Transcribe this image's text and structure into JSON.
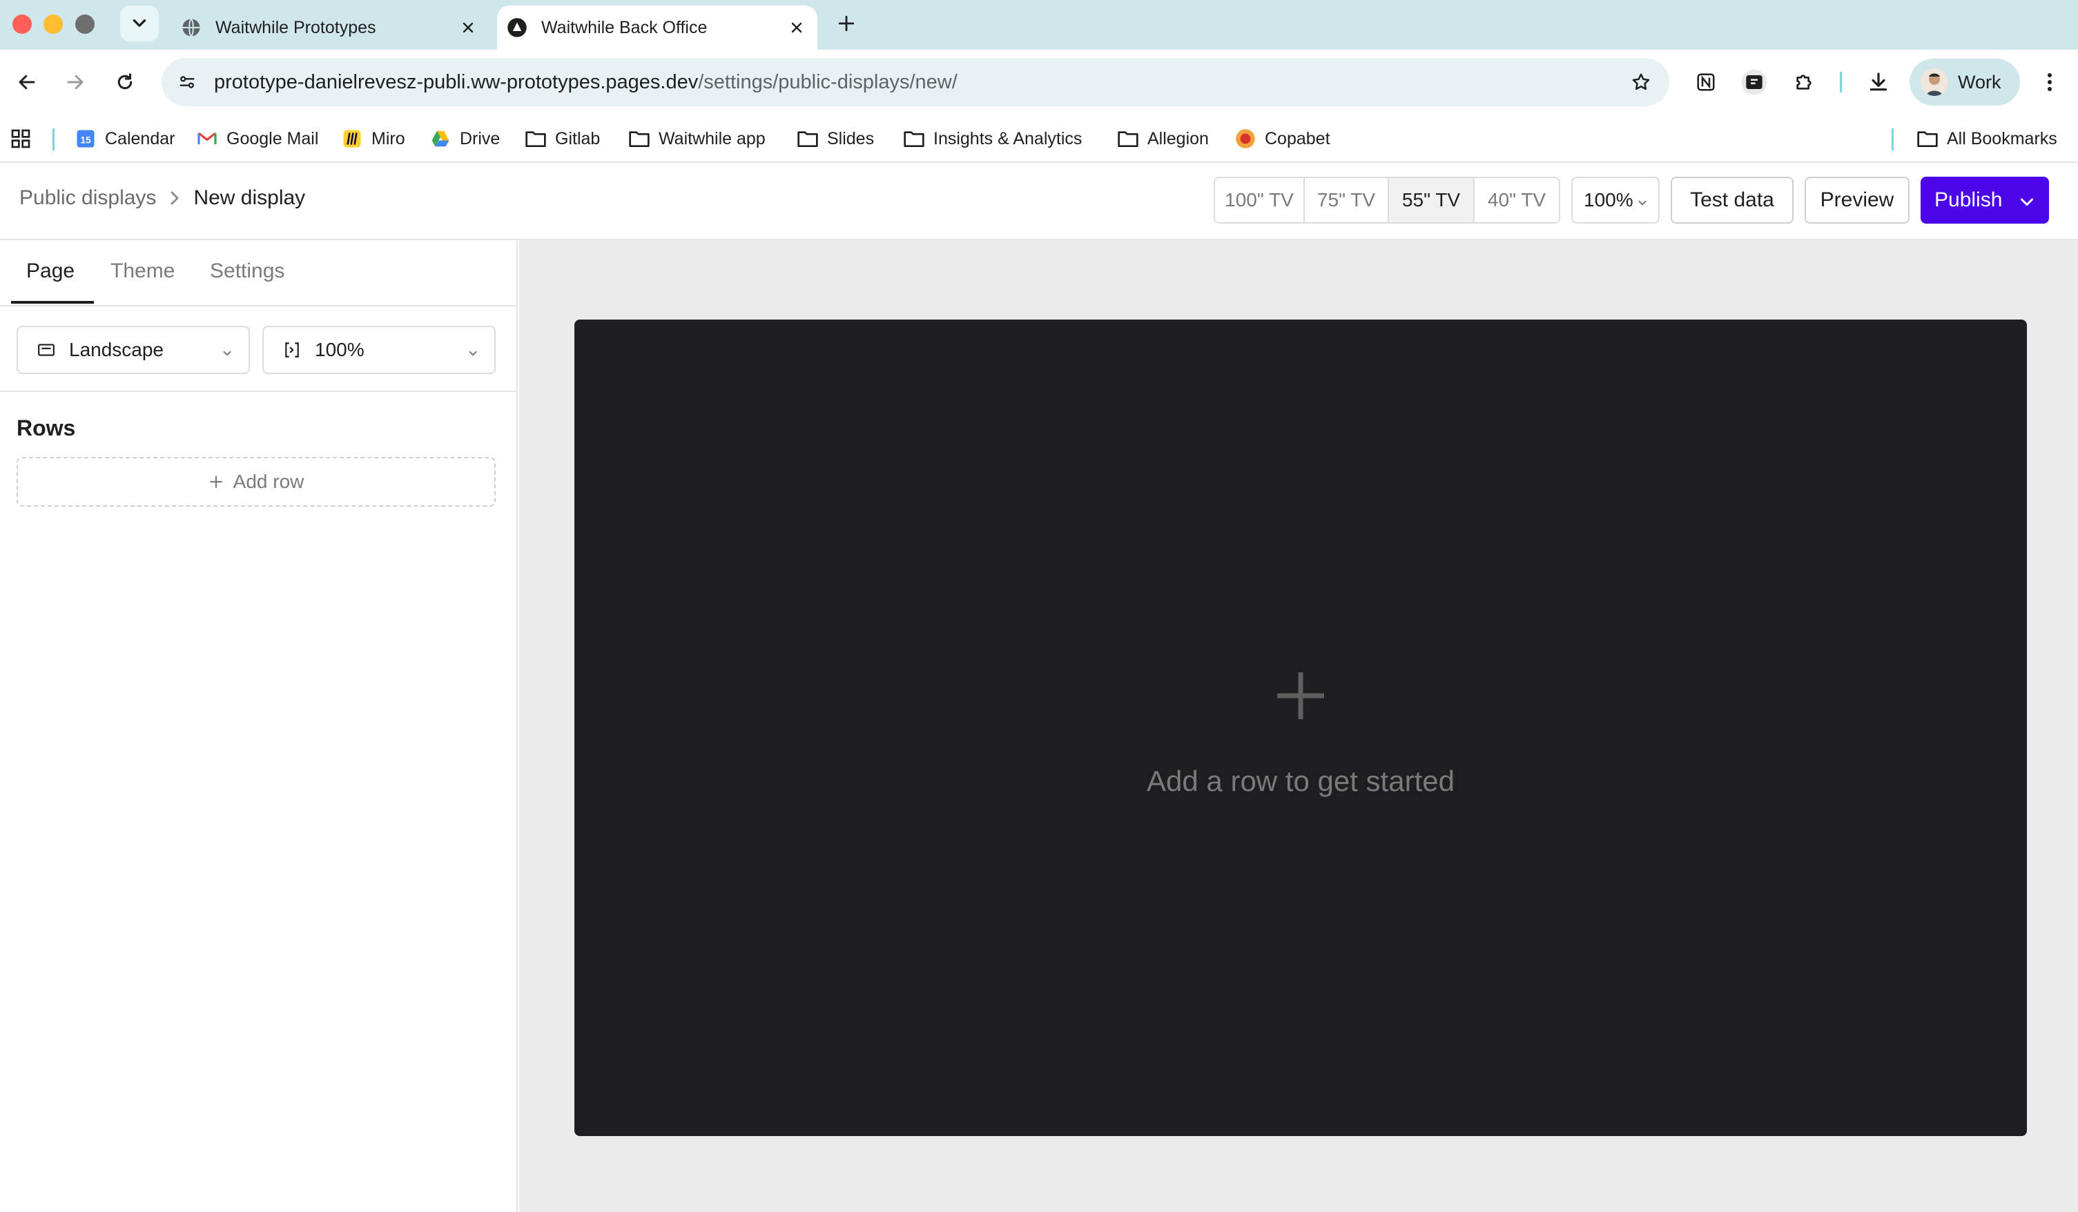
{
  "browser": {
    "tabs": [
      {
        "title": "Waitwhile Prototypes",
        "favicon": "globe-icon",
        "active": false
      },
      {
        "title": "Waitwhile Back Office",
        "favicon": "waitwhile-logo-icon",
        "active": true
      }
    ],
    "url": {
      "host": "prototype-danielrevesz-publi.ww-prototypes.pages.dev",
      "path": "/settings/public-displays/new/"
    },
    "profile_label": "Work",
    "bookmarks": [
      {
        "label": "Calendar",
        "icon": "calendar-icon"
      },
      {
        "label": "Google Mail",
        "icon": "gmail-icon"
      },
      {
        "label": "Miro",
        "icon": "miro-icon"
      },
      {
        "label": "Drive",
        "icon": "drive-icon"
      },
      {
        "label": "Gitlab",
        "icon": "folder-icon"
      },
      {
        "label": "Waitwhile app",
        "icon": "folder-icon"
      },
      {
        "label": "Slides",
        "icon": "folder-icon"
      },
      {
        "label": "Insights & Analytics",
        "icon": "folder-icon"
      },
      {
        "label": "Allegion",
        "icon": "folder-icon"
      },
      {
        "label": "Copabet",
        "icon": "copabet-icon"
      }
    ],
    "all_bookmarks_label": "All Bookmarks",
    "calendar_badge": "15"
  },
  "header": {
    "breadcrumb_parent": "Public displays",
    "breadcrumb_current": "New display",
    "screen_sizes": [
      "100\" TV",
      "75\" TV",
      "55\" TV",
      "40\" TV"
    ],
    "selected_size": "55\" TV",
    "zoom": "100%",
    "test_data_label": "Test data",
    "preview_label": "Preview",
    "publish_label": "Publish"
  },
  "sidebar": {
    "tabs": [
      "Page",
      "Theme",
      "Settings"
    ],
    "active_tab": "Page",
    "orientation": "Landscape",
    "scale": "100%",
    "rows_heading": "Rows",
    "add_row_label": "Add row"
  },
  "canvas": {
    "empty_message": "Add a row to get started"
  },
  "colors": {
    "accent": "#4a05e8",
    "canvas_bg": "#ebebeb",
    "display_bg": "#1e1e20"
  }
}
